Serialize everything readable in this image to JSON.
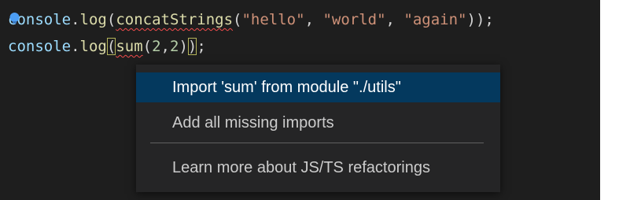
{
  "editor": {
    "line1": {
      "ident1": "console",
      "dot1": ".",
      "method1": "log",
      "paren_open": "(",
      "fn": "concatStrings",
      "paren_open2": "(",
      "arg1": "\"hello\"",
      "comma1": ", ",
      "arg2": "\"world\"",
      "comma2": ", ",
      "arg3": "\"again\"",
      "close": "));"
    },
    "line2": {
      "ident1": "console",
      "dot1": ".",
      "method1": "log",
      "paren_open": "(",
      "fn": "sum",
      "paren_open2": "(",
      "num1": "2",
      "comma": ",",
      "num2": "2",
      "paren_close": ")",
      "paren_close2": ")",
      "semicolon": ";"
    }
  },
  "quick_fix_menu": {
    "items": [
      {
        "label": "Import 'sum' from module \"./utils\"",
        "selected": true
      },
      {
        "label": "Add all missing imports",
        "selected": false
      },
      {
        "label": "Learn more about JS/TS refactorings",
        "selected": false
      }
    ]
  },
  "icons": {
    "lightbulb": "lightbulb-icon"
  },
  "colors": {
    "editor_background": "#1e1e1e",
    "menu_background": "#252526",
    "selected_item": "#04395e",
    "error_squiggle": "#f14c4c",
    "lightbulb": "#4c9df3"
  }
}
